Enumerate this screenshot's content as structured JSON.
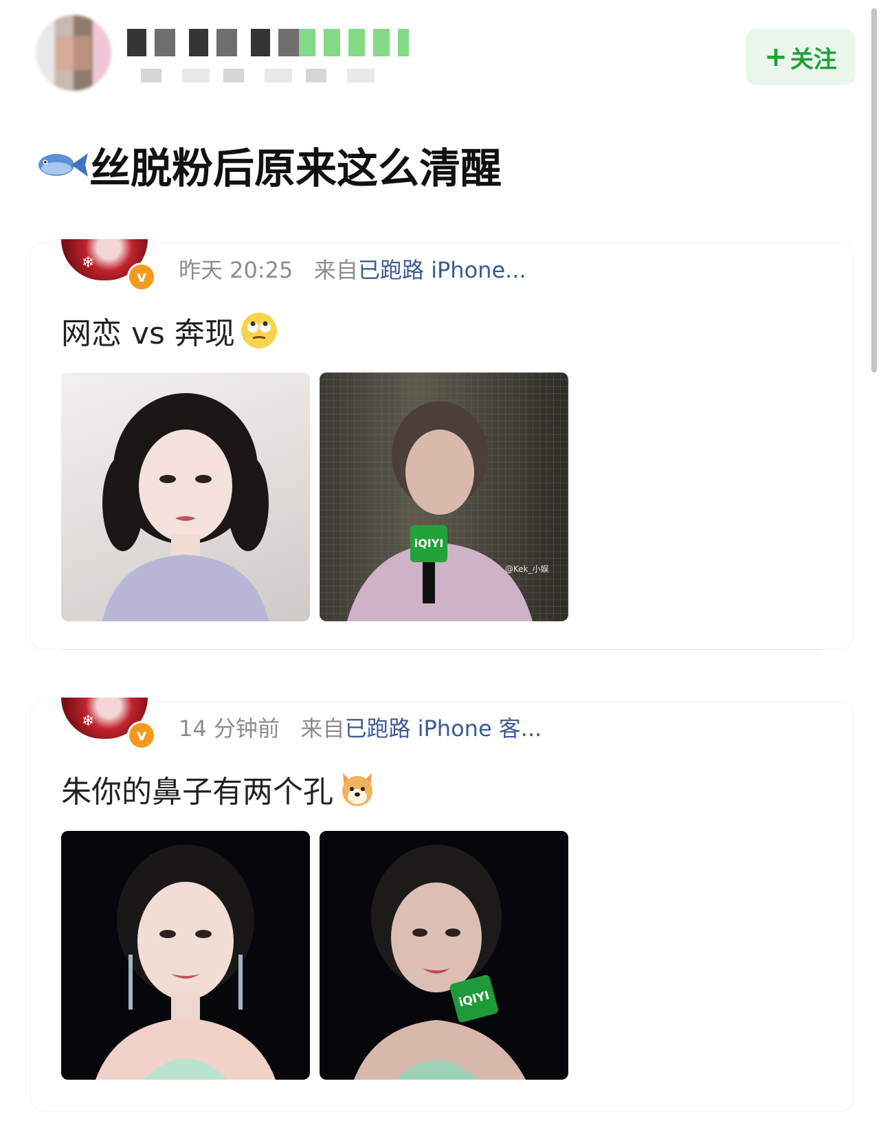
{
  "header": {
    "follow_label": "关注",
    "follow_plus": "+"
  },
  "post": {
    "title": "丝脱粉后原来这么清醒"
  },
  "cards": [
    {
      "time": "昨天 20:25",
      "from": "来自",
      "source": "已跑路 iPhone...",
      "text": "网恋 vs 奔现",
      "emoji": "face-with-rolling-eyes",
      "photos": [
        {
          "style": "light",
          "logo": ""
        },
        {
          "style": "stage",
          "logo": "iQIYI",
          "credit": "@Kek_小娱"
        }
      ]
    },
    {
      "time": "14 分钟前",
      "from": "来自",
      "source": "已跑路 iPhone 客...",
      "text": "朱你的鼻子有两个孔",
      "emoji": "dog-face",
      "photos": [
        {
          "style": "dark",
          "logo": ""
        },
        {
          "style": "dark",
          "logo": "iQIYI"
        }
      ]
    }
  ],
  "colors": {
    "follow_green": "#21a136",
    "follow_bg": "#e9f6ec",
    "source_blue": "#3b5a93",
    "meta_gray": "#8c8c8c",
    "vip_orange": "#f39a1e"
  },
  "icons": {
    "title_prefix": "fish-icon",
    "verified": "v-badge-icon"
  }
}
